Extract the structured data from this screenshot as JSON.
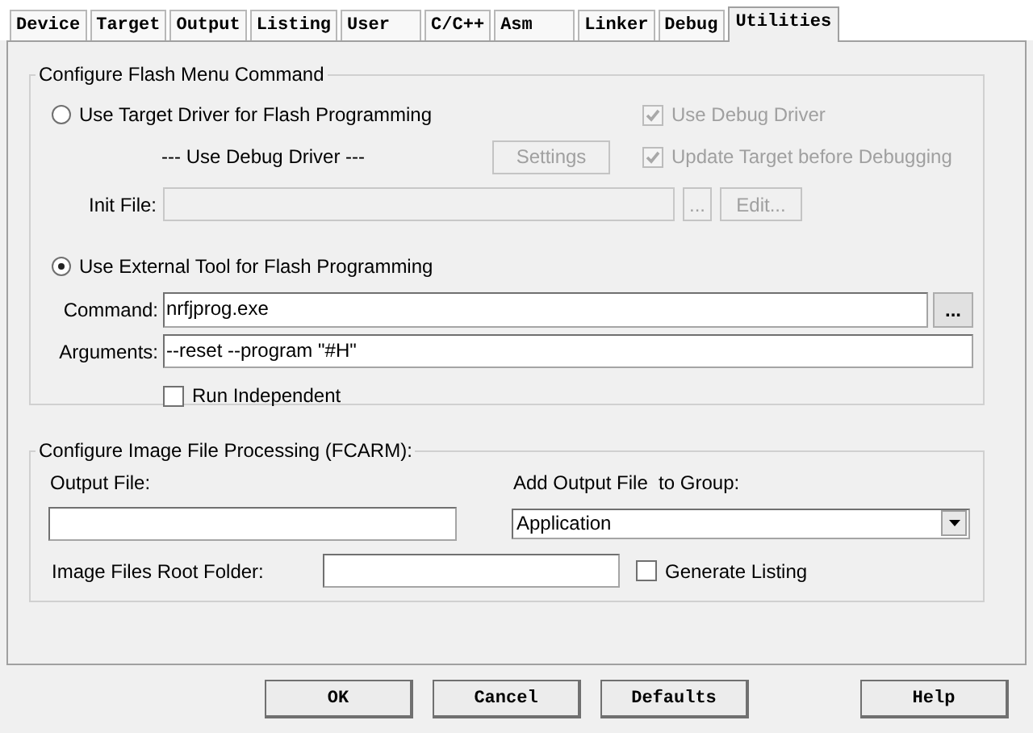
{
  "tabs": [
    {
      "label": "Device",
      "selected": false
    },
    {
      "label": "Target",
      "selected": false
    },
    {
      "label": "Output",
      "selected": false
    },
    {
      "label": "Listing",
      "selected": false
    },
    {
      "label": "User",
      "selected": false
    },
    {
      "label": "C/C++",
      "selected": false
    },
    {
      "label": "Asm",
      "selected": false
    },
    {
      "label": "Linker",
      "selected": false
    },
    {
      "label": "Debug",
      "selected": false
    },
    {
      "label": "Utilities",
      "selected": true
    }
  ],
  "flash_menu": {
    "title": "Configure Flash Menu Command",
    "target_driver": {
      "label": "Use Target Driver for Flash Programming",
      "selected": false
    },
    "use_debug_driver": {
      "label": "Use Debug Driver",
      "checked": true,
      "disabled": true
    },
    "driver_label": "--- Use Debug Driver ---",
    "settings_button": {
      "label": "Settings",
      "disabled": true
    },
    "update_target": {
      "label": "Update Target before Debugging",
      "checked": true,
      "disabled": true
    },
    "init_file": {
      "label": "Init File:",
      "disabled": true
    },
    "init_browse_button": {
      "label": "...",
      "disabled": true
    },
    "edit_button": {
      "label": "Edit...",
      "disabled": true
    },
    "external_tool": {
      "label": "Use External Tool for Flash Programming",
      "selected": true
    },
    "command": {
      "label": "Command:",
      "value": "nrfjprog.exe"
    },
    "command_browse_button": {
      "label": "...",
      "disabled": false
    },
    "arguments": {
      "label": "Arguments:",
      "value": "--reset --program \"#H\""
    },
    "run_independent": {
      "label": "Run Independent",
      "checked": false,
      "disabled": false
    }
  },
  "image_processing": {
    "title": "Configure Image File Processing (FCARM):",
    "output_file": {
      "label": "Output File:"
    },
    "add_to_group": {
      "label": "Add Output File  to Group:",
      "value": "Application"
    },
    "root_folder": {
      "label": "Image Files Root Folder:"
    },
    "generate_listing": {
      "label": "Generate Listing",
      "checked": false,
      "disabled": false
    }
  },
  "buttons": [
    {
      "label": "OK"
    },
    {
      "label": "Cancel"
    },
    {
      "label": "Defaults"
    },
    {
      "label": "Help"
    }
  ]
}
